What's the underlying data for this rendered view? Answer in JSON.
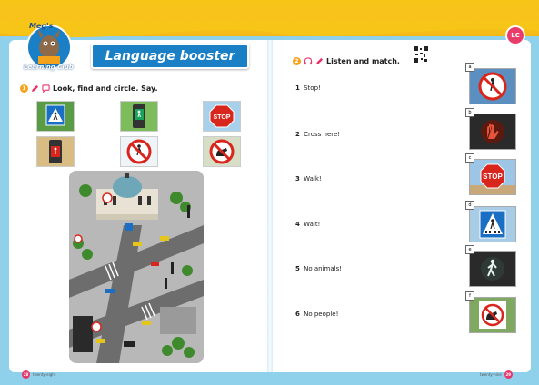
{
  "header": {
    "logo_top": "Meg's",
    "logo_bottom": "Learning Club",
    "banner_title": "Language booster",
    "badge": "LC"
  },
  "left_page": {
    "activity": {
      "number": "1",
      "instruction": "Look, find and circle. Say."
    },
    "signs": [
      {
        "icon": "pedestrian-crossing-sign-icon"
      },
      {
        "icon": "walk-signal-icon"
      },
      {
        "icon": "stop-sign-icon",
        "text": "STOP"
      },
      {
        "icon": "dont-walk-signal-icon"
      },
      {
        "icon": "no-pedestrians-sign-icon"
      },
      {
        "icon": "no-animals-sign-icon"
      }
    ],
    "footer": {
      "page_number": "28",
      "page_word": "twenty-eight"
    }
  },
  "right_page": {
    "activity": {
      "number": "2",
      "instruction": "Listen and match."
    },
    "items": [
      {
        "number": "1",
        "text": "Stop!"
      },
      {
        "number": "2",
        "text": "Cross here!"
      },
      {
        "number": "3",
        "text": "Walk!"
      },
      {
        "number": "4",
        "text": "Wait!"
      },
      {
        "number": "5",
        "text": "No animals!"
      },
      {
        "number": "6",
        "text": "No people!"
      }
    ],
    "photos": [
      {
        "letter": "a",
        "icon": "no-pedestrians-photo-icon"
      },
      {
        "letter": "b",
        "icon": "red-hand-signal-photo-icon"
      },
      {
        "letter": "c",
        "icon": "stop-sign-photo-icon",
        "text": "STOP"
      },
      {
        "letter": "d",
        "icon": "pedestrian-crossing-photo-icon"
      },
      {
        "letter": "e",
        "icon": "walk-signal-photo-icon"
      },
      {
        "letter": "f",
        "icon": "no-dogs-photo-icon"
      }
    ],
    "footer": {
      "page_number": "29",
      "page_word": "twenty-nine"
    }
  },
  "colors": {
    "accent_yellow": "#f7c418",
    "banner_blue": "#1a7fc4",
    "sky": "#8fd0ea",
    "stop_red": "#d9261c",
    "pink": "#e8356a"
  }
}
